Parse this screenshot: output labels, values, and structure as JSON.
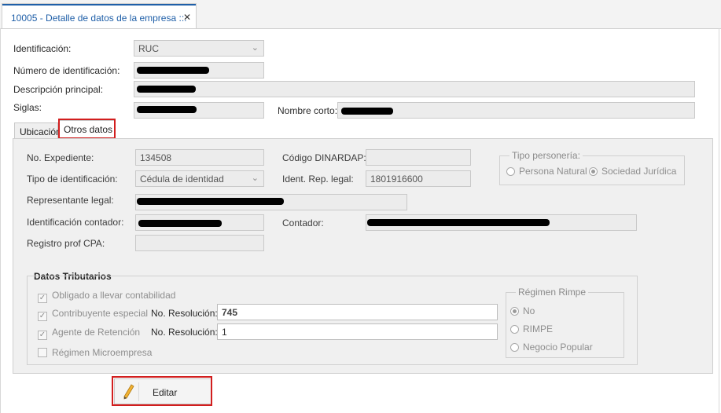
{
  "window": {
    "tab_title": "10005 - Detalle de datos de la empresa",
    "tab_pin_glyph": "::.",
    "tab_close": "✕"
  },
  "form": {
    "identificacion": {
      "label": "Identificación:",
      "value": "RUC",
      "icon": "chevron-down-icon"
    },
    "numero_identificacion": {
      "label": "Número de identificación:",
      "value": ""
    },
    "descripcion_principal": {
      "label": "Descripción principal:",
      "value": ""
    },
    "siglas": {
      "label": "Siglas:",
      "value": ""
    },
    "nombre_corto": {
      "label": "Nombre corto:",
      "value": ""
    }
  },
  "tabs": [
    {
      "label": "Ubicación",
      "active": false
    },
    {
      "label": "Otros datos",
      "active": true
    }
  ],
  "otros_datos": {
    "no_expediente": {
      "label": "No. Expediente:",
      "value": "134508"
    },
    "codigo_dinardap": {
      "label": "Código DINARDAP:",
      "value": ""
    },
    "tipo_identificacion": {
      "label": "Tipo de identificación:",
      "value": "Cédula de identidad",
      "icon": "chevron-down-icon"
    },
    "ident_rep_legal": {
      "label": "Ident. Rep. legal:",
      "value": "1801916600"
    },
    "representante_legal": {
      "label": "Representante legal:",
      "value": ""
    },
    "identificacion_contador": {
      "label": "Identificación contador:",
      "value": ""
    },
    "contador": {
      "label": "Contador:",
      "value": ""
    },
    "registro_prof_cpa": {
      "label": "Registro prof CPA:",
      "value": ""
    },
    "tipo_personeria": {
      "legend": "Tipo personería:",
      "options": [
        {
          "label": "Persona Natural",
          "selected": false
        },
        {
          "label": "Sociedad Jurídica",
          "selected": true
        }
      ]
    }
  },
  "datos_tributarios": {
    "title": "Datos Tributarios",
    "obligado_contabilidad": {
      "label": "Obligado a llevar contabilidad",
      "checked": true
    },
    "contribuyente_especial": {
      "label": "Contribuyente especial",
      "checked": true,
      "resolucion_label": "No. Resolución:",
      "resolucion_value": "745"
    },
    "agente_retencion": {
      "label": "Agente de Retención",
      "checked": true,
      "resolucion_label": "No. Resolución:",
      "resolucion_value": "1"
    },
    "regimen_microempresa": {
      "label": "Régimen Microempresa",
      "checked": false
    },
    "regimen_rimpe": {
      "legend": "Régimen Rimpe",
      "options": [
        {
          "label": "No",
          "selected": true
        },
        {
          "label": "RIMPE",
          "selected": false
        },
        {
          "label": "Negocio Popular",
          "selected": false
        }
      ]
    }
  },
  "actions": {
    "edit_label": "Editar",
    "edit_icon": "pencil-icon"
  },
  "colors": {
    "accent": "#1f5fa8",
    "highlight": "#d21e1e"
  }
}
